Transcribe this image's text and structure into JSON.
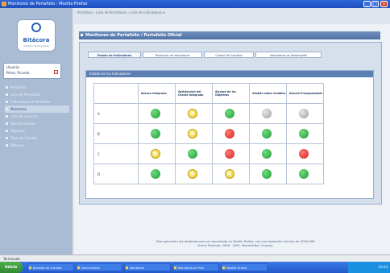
{
  "window": {
    "title": "Monitoreo de Portafolio - Mozilla Firefox",
    "min": "_",
    "max": "□",
    "close": "x"
  },
  "address_bar": {
    "text": "Portafolio   ›  Lista de Portafolios  ›  Lista de Indicadores ▾"
  },
  "logo": {
    "name": "Bitácora",
    "tagline": "Gestión de Proyectos"
  },
  "user": {
    "line1": "Usuario:",
    "line2": "Pérez, Ricardo",
    "logout": "x"
  },
  "sidebar_menu": [
    {
      "label": "Portafolio"
    },
    {
      "label": "Lista de Proyectos"
    },
    {
      "label": "Indicadores de Portafolio"
    },
    {
      "label": "Monitoreo",
      "selected": true
    },
    {
      "label": "Lista de Usuarios"
    },
    {
      "label": "Documentación"
    },
    {
      "label": "Reportes"
    },
    {
      "label": "Tipos de Cambio"
    },
    {
      "label": "Bitácora"
    }
  ],
  "page_title": "Monitoreo de Portafolio / Portafolio Oficial",
  "tabs": [
    {
      "label": "Estado de Indicadores",
      "active": true
    },
    {
      "label": "Tendencia de Indicadores"
    },
    {
      "label": "Control de Cambios"
    },
    {
      "label": "Indicadores de Desempeño"
    }
  ],
  "card_title": "Estado de los Indicadores",
  "table": {
    "columns": [
      "Avance Integrado",
      "Satisfacción del Cliente Integrado",
      "Alcance de los Objetivos",
      "Gestión sobre Cambios",
      "Avance Presupuestado"
    ],
    "rows": [
      {
        "label": "A",
        "lights": [
          "green",
          "yellow",
          "green",
          "gray",
          "gray"
        ]
      },
      {
        "label": "B",
        "lights": [
          "green",
          "yellow",
          "red",
          "green",
          "green"
        ]
      },
      {
        "label": "C",
        "lights": [
          "yellow",
          "green",
          "red",
          "green",
          "red"
        ]
      },
      {
        "label": "D",
        "lights": [
          "green",
          "yellow",
          "yellow",
          "green",
          "green"
        ]
      }
    ]
  },
  "footer": {
    "line1": "Esta aplicación fue diseñada para ser visualizada en Mozilla Firefox, con una resolución mínima de 1024x768",
    "line2": "Virtual Proyecto, 2006 - 2009. Montevideo, Uruguay."
  },
  "status_bar": "Terminado",
  "taskbar": {
    "start": "Inicio",
    "tasks": [
      "Bandeja de entrada",
      "Documentos",
      "Monitoreo",
      "Monitoreo de Port",
      "Mozilla Firefox"
    ],
    "clock": "10:24"
  }
}
